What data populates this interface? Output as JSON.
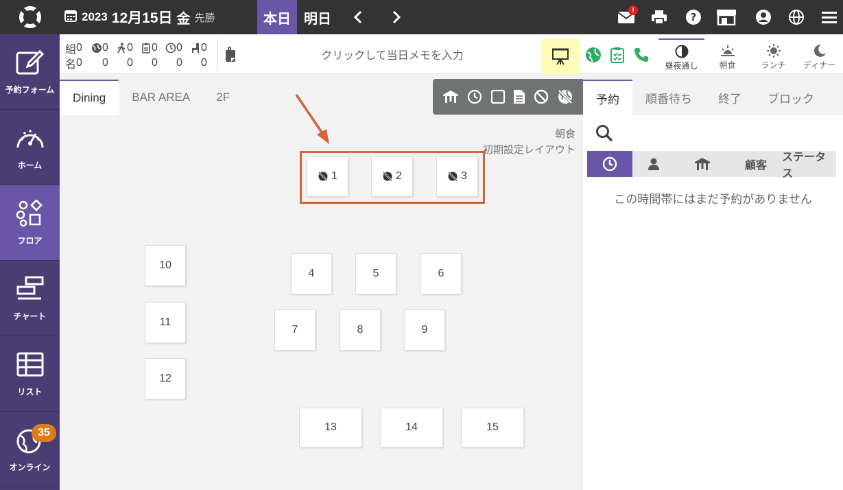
{
  "header": {
    "year": "2023",
    "month_day": "12月15日",
    "weekday": "金",
    "rokuyo": "先勝",
    "today_label": "本日",
    "tomorrow_label": "明日",
    "mail_badge": "!",
    "icons": [
      "mail-icon",
      "print-icon",
      "help-icon",
      "store-icon",
      "account-icon",
      "globe-icon",
      "menu-icon"
    ]
  },
  "sidebar": {
    "items": [
      {
        "label": "予約フォーム",
        "icon": "edit-icon"
      },
      {
        "label": "ホーム",
        "icon": "dashboard-icon"
      },
      {
        "label": "フロア",
        "icon": "shapes-icon"
      },
      {
        "label": "チャート",
        "icon": "chart-icon"
      },
      {
        "label": "リスト",
        "icon": "list-icon"
      },
      {
        "label": "オンライン",
        "icon": "online-icon",
        "badge": "35"
      }
    ]
  },
  "stats": {
    "row1": {
      "label": "組",
      "values": [
        "0",
        "0",
        "0",
        "0",
        "0",
        "0"
      ]
    },
    "row2": {
      "label": "名",
      "values": [
        "0",
        "0",
        "0",
        "0",
        "0",
        "0"
      ]
    }
  },
  "memo": {
    "placeholder": "クリックして当日メモを入力"
  },
  "meal_tabs": [
    {
      "label": "昼夜通し",
      "icon": "day-night-icon"
    },
    {
      "label": "朝食",
      "icon": "sunrise-icon"
    },
    {
      "label": "ランチ",
      "icon": "sun-icon"
    },
    {
      "label": "ディナー",
      "icon": "moon-icon"
    }
  ],
  "floor_tabs": [
    "Dining",
    "BAR AREA",
    "2F"
  ],
  "layout_info": {
    "line1": "朝食",
    "line2": "初期設定レイアウト"
  },
  "tables": [
    "1",
    "2",
    "3",
    "4",
    "5",
    "6",
    "7",
    "8",
    "9",
    "10",
    "11",
    "12",
    "13",
    "14",
    "15"
  ],
  "right_panel": {
    "tabs": [
      "予約",
      "順番待ち",
      "終了",
      "ブロック"
    ],
    "columns": {
      "customer": "顧客",
      "status": "ステータス"
    },
    "empty_message": "この時間帯にはまだ予約がありません"
  },
  "colors": {
    "accent": "#6a56a8",
    "sidebar": "#4a3d73",
    "highlight": "#d6613a",
    "online_badge": "#e07b1a"
  }
}
